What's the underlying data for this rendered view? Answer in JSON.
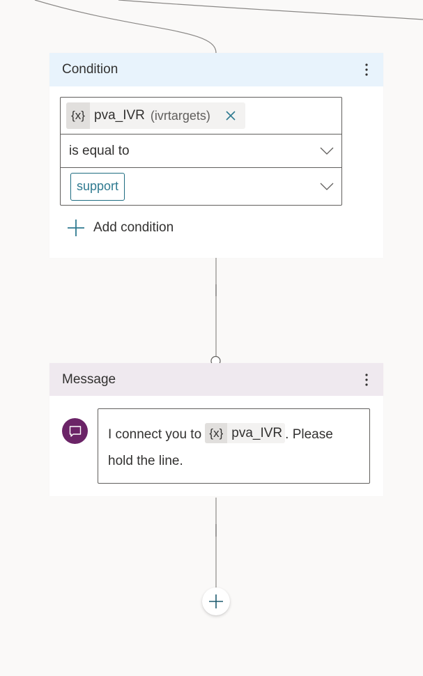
{
  "canvas": {
    "background": "#faf9f8",
    "connector_color": "#8a8886"
  },
  "condition_node": {
    "title": "Condition",
    "header_color": "#e8f3fc",
    "more_icon": "more-vertical-icon",
    "variable": {
      "icon_label": "{x}",
      "name": "pva_IVR",
      "type": "(ivrtargets)",
      "remove_icon": "close-icon"
    },
    "operator": {
      "selected": "is equal to",
      "dropdown_icon": "chevron-down-icon"
    },
    "value": {
      "selected": "support",
      "dropdown_icon": "chevron-down-icon"
    },
    "add_condition_label": "Add condition",
    "accent_color": "#2f7a90"
  },
  "message_node": {
    "title": "Message",
    "header_color": "#efe9ef",
    "more_icon": "more-vertical-icon",
    "avatar_icon": "chat-message-icon",
    "avatar_color": "#6b2467",
    "text_before": "I connect you to ",
    "variable": {
      "icon_label": "{x}",
      "name": "pva_IVR"
    },
    "text_after": ". Please hold the line."
  },
  "add_node_button": {
    "icon": "plus-icon"
  }
}
